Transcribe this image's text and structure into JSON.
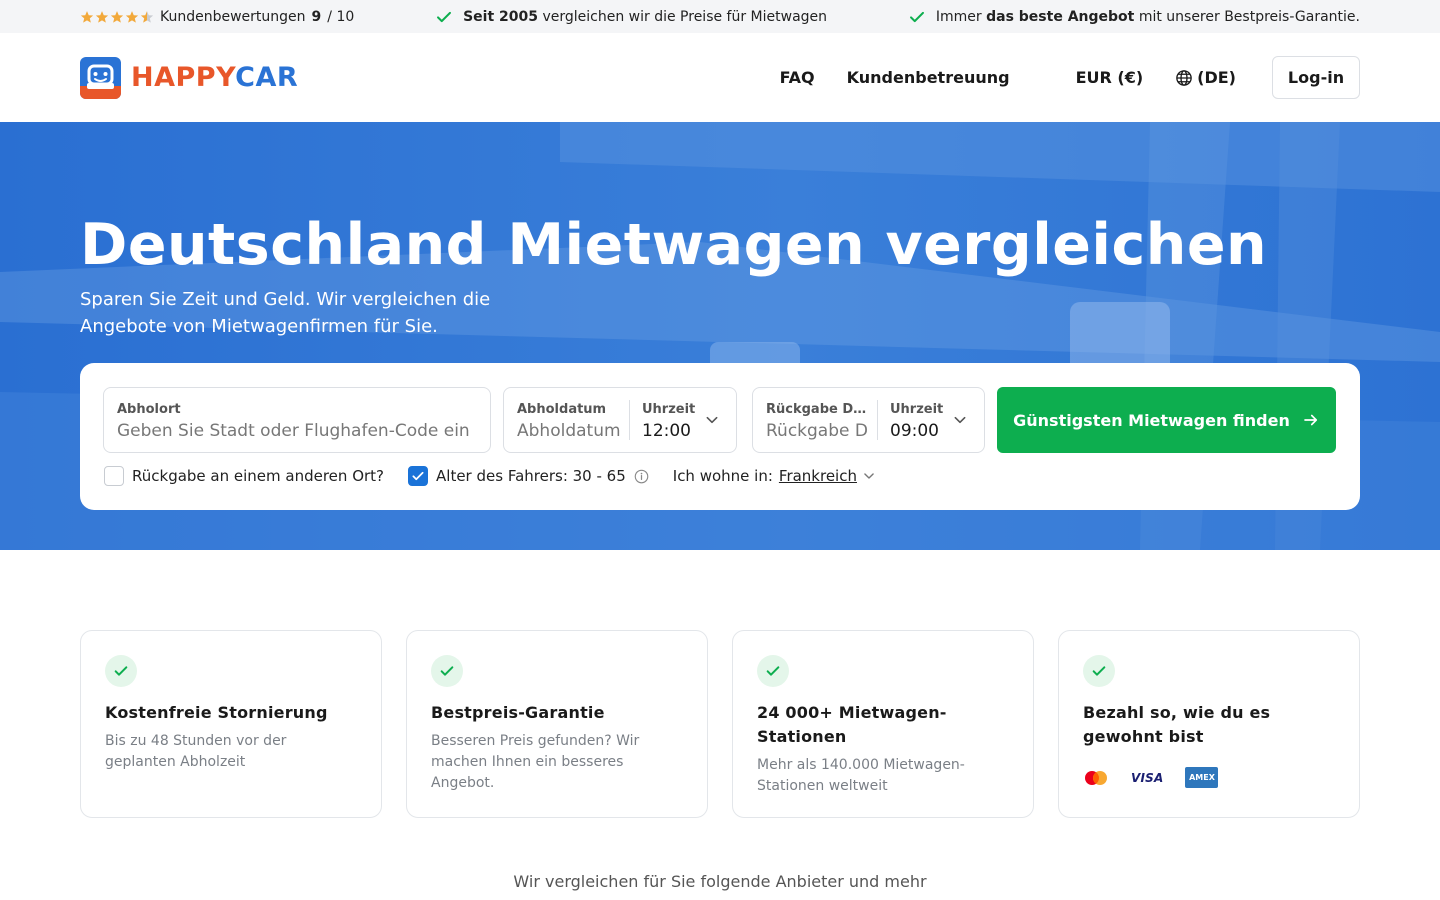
{
  "topbar": {
    "reviews_label": "Kundenbewertungen",
    "reviews_score": "9",
    "reviews_sep": "/ 10",
    "rating_stars": 4.5,
    "since_bold": "Seit 2005",
    "since_rest": "vergleichen wir die Preise für Mietwagen",
    "best_prefix": "Immer",
    "best_bold": "das beste Angebot",
    "best_rest": "mit unserer Bestpreis-Garantie."
  },
  "header": {
    "logo_happy": "HAPPY",
    "logo_car": "CAR",
    "nav_faq": "FAQ",
    "nav_support": "Kundenbetreuung",
    "currency": "EUR (€)",
    "language": "(DE)",
    "login": "Log-in"
  },
  "hero": {
    "title": "Deutschland Mietwagen vergleichen",
    "subtitle": "Sparen Sie Zeit und Geld. Wir vergleichen die Angebote von Mietwagenfirmen für Sie."
  },
  "search": {
    "pickup_location_label": "Abholort",
    "pickup_location_placeholder": "Geben Sie Stadt oder Flughafen-Code ein",
    "pickup_date_label": "Abholdatum",
    "pickup_date_placeholder": "Abholdatum",
    "pickup_time_label": "Uhrzeit",
    "pickup_time_value": "12:00",
    "return_date_label": "Rückgabe Da...",
    "return_date_placeholder": "Rückgabe Da",
    "return_time_label": "Uhrzeit",
    "return_time_value": "09:00",
    "submit_label": "Günstigsten Mietwagen finden",
    "other_return_label": "Rückgabe an einem anderen Ort?",
    "driver_age_label": "Alter des Fahrers: 30 - 65",
    "residence_label": "Ich wohne in:",
    "residence_value": "Frankreich"
  },
  "features": [
    {
      "title": "Kostenfreie Stornierung",
      "text": "Bis zu 48 Stunden vor der geplanten Abholzeit"
    },
    {
      "title": "Bestpreis-Garantie",
      "text": "Besseren Preis gefunden? Wir machen Ihnen ein besseres Angebot."
    },
    {
      "title": "24 000+ Mietwagen-Stationen",
      "text": "Mehr als 140.000 Mietwagen-Stationen weltweit"
    },
    {
      "title": "Bezahl so, wie du es gewohnt bist",
      "text": ""
    }
  ],
  "payments": {
    "visa": "VISA",
    "amex": "AMEX"
  },
  "providers_caption": "Wir vergleichen für Sie folgende Anbieter und mehr",
  "colors": {
    "brand_blue": "#2a73d5",
    "brand_orange": "#e8572a",
    "cta_green": "#0dae4f",
    "star": "#f2a93b"
  }
}
